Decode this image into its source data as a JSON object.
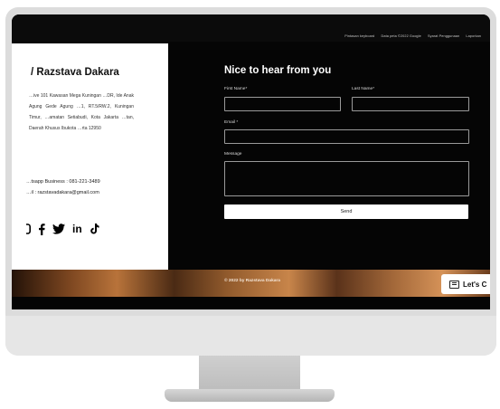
{
  "map": {
    "attribution": [
      "Pintasan keyboard",
      "Data peta ©2022 Google",
      "Syarat Penggunaan",
      "Laporkan"
    ]
  },
  "contact": {
    "brand": "/ Razstava Dakara",
    "address": "…ive 101 Kawasan Mega Kuningan …DR, Ide Anak Agung Gede Agung …1, RT.5/RW.2, Kuningan Timur, …amatan Setiabudi, Kota Jakarta …tan, Daerah Khusus Ibukota …rta 12950",
    "whatsapp": "…tsapp Business : 081-221-3489",
    "email": "…il : razstavadakara@gmail.com",
    "social_icons": [
      "instagram-icon",
      "facebook-icon",
      "twitter-icon",
      "linkedin-icon",
      "tiktok-icon"
    ]
  },
  "form": {
    "title": "Nice to hear from you",
    "first_name_label": "First Name*",
    "last_name_label": "Last Name*",
    "email_label": "Email *",
    "message_label": "Message",
    "send_label": "Send"
  },
  "footer": {
    "copyright": "© 2022 by Razstava Dakara",
    "chat_label": "Let's C"
  },
  "colors": {
    "screen_bg": "#050505",
    "panel_bg": "#ffffff",
    "bezel": "#dcdcdc"
  }
}
